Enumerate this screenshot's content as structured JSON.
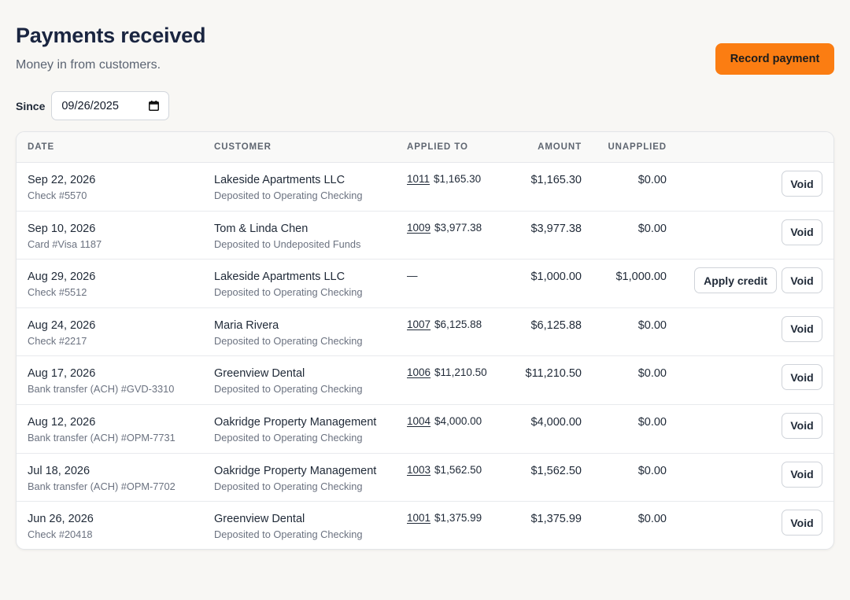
{
  "header": {
    "title": "Payments received",
    "subtitle": "Money in from customers.",
    "record_label": "Record payment"
  },
  "filter": {
    "since_label": "Since",
    "since_value": "09/26/2025"
  },
  "table": {
    "columns": {
      "date": "DATE",
      "customer": "CUSTOMER",
      "applied": "APPLIED TO",
      "amount": "AMOUNT",
      "unapplied": "UNAPPLIED"
    },
    "void_label": "Void",
    "apply_credit_label": "Apply credit",
    "rows": [
      {
        "date": "Sep 22, 2026",
        "method": "Check #5570",
        "customer": "Lakeside Apartments LLC",
        "deposit": "Deposited to Operating Checking",
        "invoice": "1011",
        "invoice_amount": "$1,165.30",
        "amount": "$1,165.30",
        "unapplied": "$0.00"
      },
      {
        "date": "Sep 10, 2026",
        "method": "Card #Visa 1187",
        "customer": "Tom & Linda Chen",
        "deposit": "Deposited to Undeposited Funds",
        "invoice": "1009",
        "invoice_amount": "$3,977.38",
        "amount": "$3,977.38",
        "unapplied": "$0.00"
      },
      {
        "date": "Aug 29, 2026",
        "method": "Check #5512",
        "customer": "Lakeside Apartments LLC",
        "deposit": "Deposited to Operating Checking",
        "applied_none": "—",
        "amount": "$1,000.00",
        "unapplied": "$1,000.00"
      },
      {
        "date": "Aug 24, 2026",
        "method": "Check #2217",
        "customer": "Maria Rivera",
        "deposit": "Deposited to Operating Checking",
        "invoice": "1007",
        "invoice_amount": "$6,125.88",
        "amount": "$6,125.88",
        "unapplied": "$0.00"
      },
      {
        "date": "Aug 17, 2026",
        "method": "Bank transfer (ACH) #GVD-3310",
        "customer": "Greenview Dental",
        "deposit": "Deposited to Operating Checking",
        "invoice": "1006",
        "invoice_amount": "$11,210.50",
        "amount": "$11,210.50",
        "unapplied": "$0.00"
      },
      {
        "date": "Aug 12, 2026",
        "method": "Bank transfer (ACH) #OPM-7731",
        "customer": "Oakridge Property Management",
        "deposit": "Deposited to Operating Checking",
        "invoice": "1004",
        "invoice_amount": "$4,000.00",
        "amount": "$4,000.00",
        "unapplied": "$0.00"
      },
      {
        "date": "Jul 18, 2026",
        "method": "Bank transfer (ACH) #OPM-7702",
        "customer": "Oakridge Property Management",
        "deposit": "Deposited to Operating Checking",
        "invoice": "1003",
        "invoice_amount": "$1,562.50",
        "amount": "$1,562.50",
        "unapplied": "$0.00"
      },
      {
        "date": "Jun 26, 2026",
        "method": "Check #20418",
        "customer": "Greenview Dental",
        "deposit": "Deposited to Operating Checking",
        "invoice": "1001",
        "invoice_amount": "$1,375.99",
        "amount": "$1,375.99",
        "unapplied": "$0.00"
      }
    ]
  },
  "colors": {
    "accent": "#fb7d12",
    "background": "#f8f7f4",
    "title": "#1a2540"
  }
}
